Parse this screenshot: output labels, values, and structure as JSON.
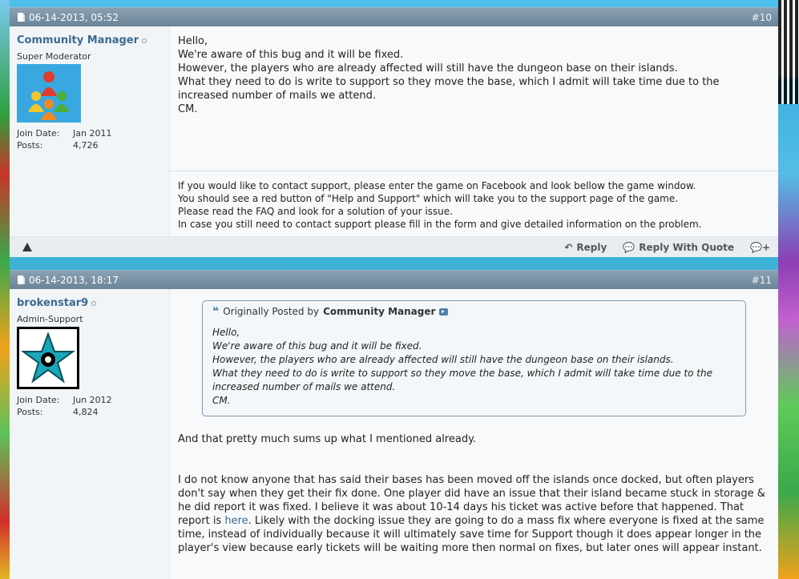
{
  "posts": [
    {
      "date": "06-14-2013, 05:52",
      "number": "#10",
      "user": {
        "name": "Community Manager",
        "title": "Super Moderator",
        "join_label": "Join Date:",
        "join_date": "Jan 2011",
        "posts_label": "Posts:",
        "posts": "4,726"
      },
      "message": [
        "Hello,",
        "We're aware of this bug and it will be fixed.",
        "However, the players who are already affected will still have the dungeon base on their islands.",
        "What they need to do is write to support so they move the base, which I admit will take time due to the increased number of mails we attend.",
        "CM."
      ],
      "signature": [
        "If you would like to contact support, please enter the game on Facebook and look bellow the game window.",
        "You should see a red button of \"Help and Support\" which will take you to the support page of the game.",
        "Please read the FAQ and look for a solution of your issue.",
        "In case you still need to contact support please fill in the form and give detailed information on the problem."
      ],
      "actions": {
        "reply": "Reply",
        "reply_quote": "Reply With Quote"
      }
    },
    {
      "date": "06-14-2013, 18:17",
      "number": "#11",
      "user": {
        "name": "brokenstar9",
        "title": "Admin-Support",
        "join_label": "Join Date:",
        "join_date": "Jun 2012",
        "posts_label": "Posts:",
        "posts": "4,824"
      },
      "quote": {
        "prefix": "Originally Posted by",
        "author": "Community Manager",
        "lines": [
          "Hello,",
          "We're aware of this bug and it will be fixed.",
          "However, the players who are already affected will still have the dungeon base on their islands.",
          "What they need to do is write to support so they move the base, which I admit will take time due to the increased number of mails we attend.",
          "CM."
        ]
      },
      "para1": "And that pretty much sums up what I mentioned already.",
      "para2_before": "I do not know anyone that has said their bases has been moved off the islands once docked, but often players don't say when they get their fix done. One player did have an issue that their island became stuck in storage & he did report it was fixed. I believe it was about 10-14 days his ticket was active before that happened. That report is ",
      "para2_link": "here",
      "para2_after": ". Likely with the docking issue they are going to do a mass fix where everyone is fixed at the same time, instead of individually because it will ultimately save time for Support though it does appear longer in the player's view because early tickets will be waiting more then normal on fixes, but later ones will appear instant."
    }
  ]
}
